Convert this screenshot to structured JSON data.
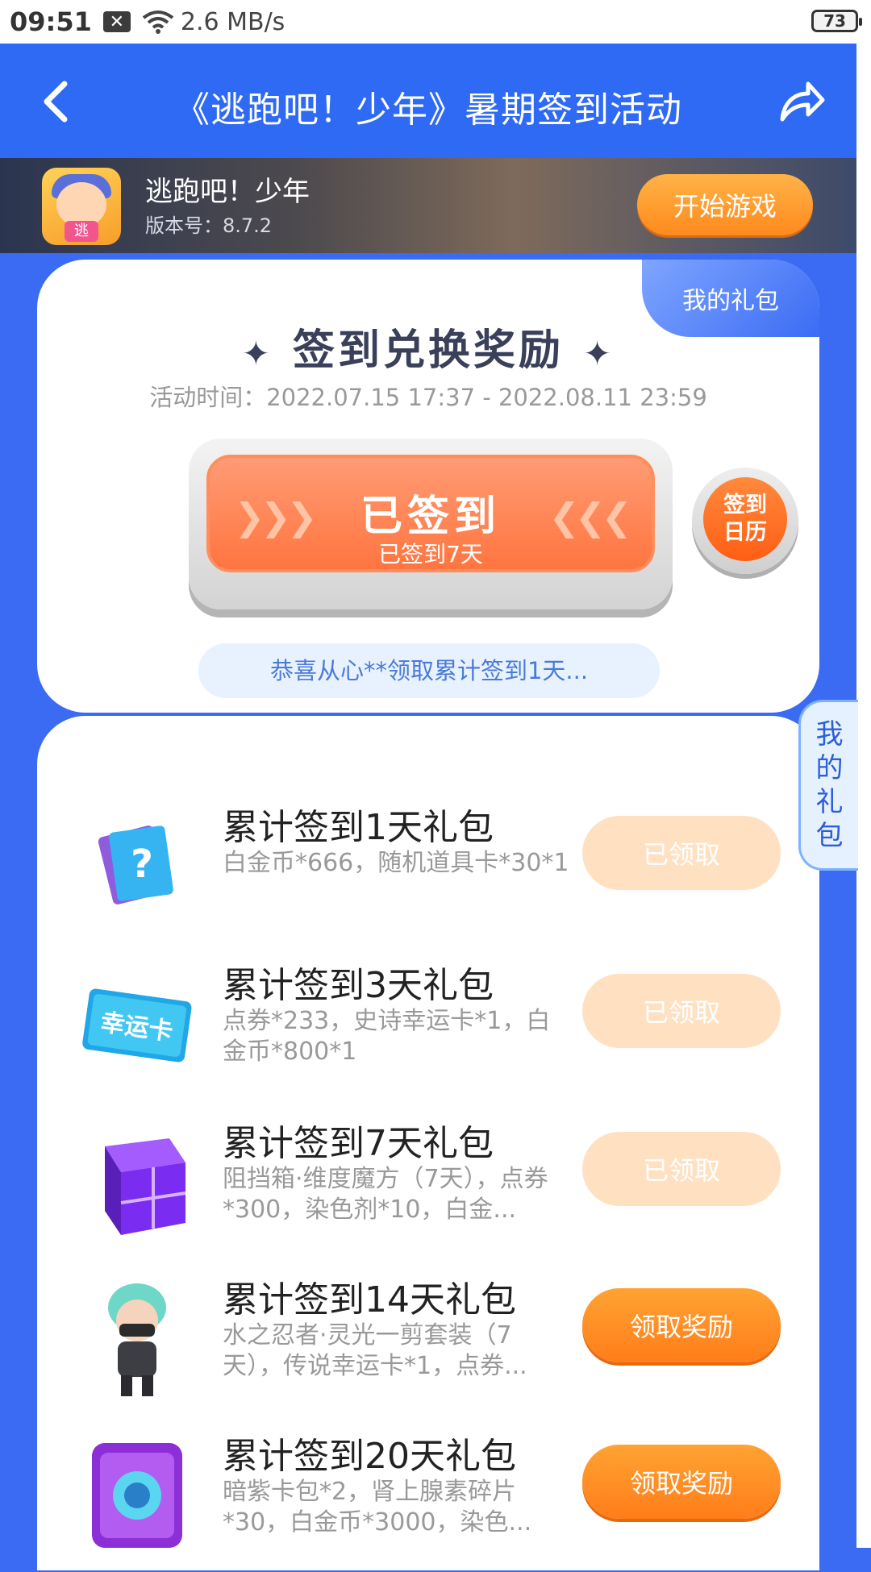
{
  "status": {
    "time": "09:51",
    "speed": "2.6 MB/s",
    "battery": "73"
  },
  "nav": {
    "title": "《逃跑吧！少年》暑期签到活动"
  },
  "game": {
    "name": "逃跑吧！少年",
    "version": "版本号：8.7.2",
    "play_label": "开始游戏",
    "icon_badge": "逃"
  },
  "checkin": {
    "my_gift_tab": "我的礼包",
    "heading": "签到兑换奖励",
    "period": "活动时间：2022.07.15 17:37 - 2022.08.11 23:59",
    "button_main": "已签到",
    "button_sub": "已签到7天",
    "calendar_label_1": "签到",
    "calendar_label_2": "日历",
    "notice": "恭喜从心**领取累计签到1天..."
  },
  "side_tab": {
    "label": "我的礼包"
  },
  "gifts": [
    {
      "title": "累计签到1天礼包",
      "desc": "白金币*666，随机道具卡*30*1",
      "button": "已领取",
      "claimed": true,
      "icon": "mystery-card-icon"
    },
    {
      "title": "累计签到3天礼包",
      "desc": "点券*233，史诗幸运卡*1，白金币*800*1",
      "button": "已领取",
      "claimed": true,
      "icon": "lucky-card-icon",
      "icon_text": "幸运卡"
    },
    {
      "title": "累计签到7天礼包",
      "desc": "阻挡箱·维度魔方（7天），点券*300，染色剂*10，白金...",
      "button": "已领取",
      "claimed": true,
      "icon": "purple-cube-icon"
    },
    {
      "title": "累计签到14天礼包",
      "desc": "水之忍者·灵光一剪套装（7天），传说幸运卡*1，点券...",
      "button": "领取奖励",
      "claimed": false,
      "icon": "ninja-character-icon"
    },
    {
      "title": "累计签到20天礼包",
      "desc": "暗紫卡包*2，肾上腺素碎片*30，白金币*3000，染色...",
      "button": "领取奖励",
      "claimed": false,
      "icon": "purple-card-pack-icon"
    }
  ],
  "colors": {
    "primary": "#2f6af5",
    "orange": "#ff7d1a",
    "claimed": "#ffe1c2"
  }
}
